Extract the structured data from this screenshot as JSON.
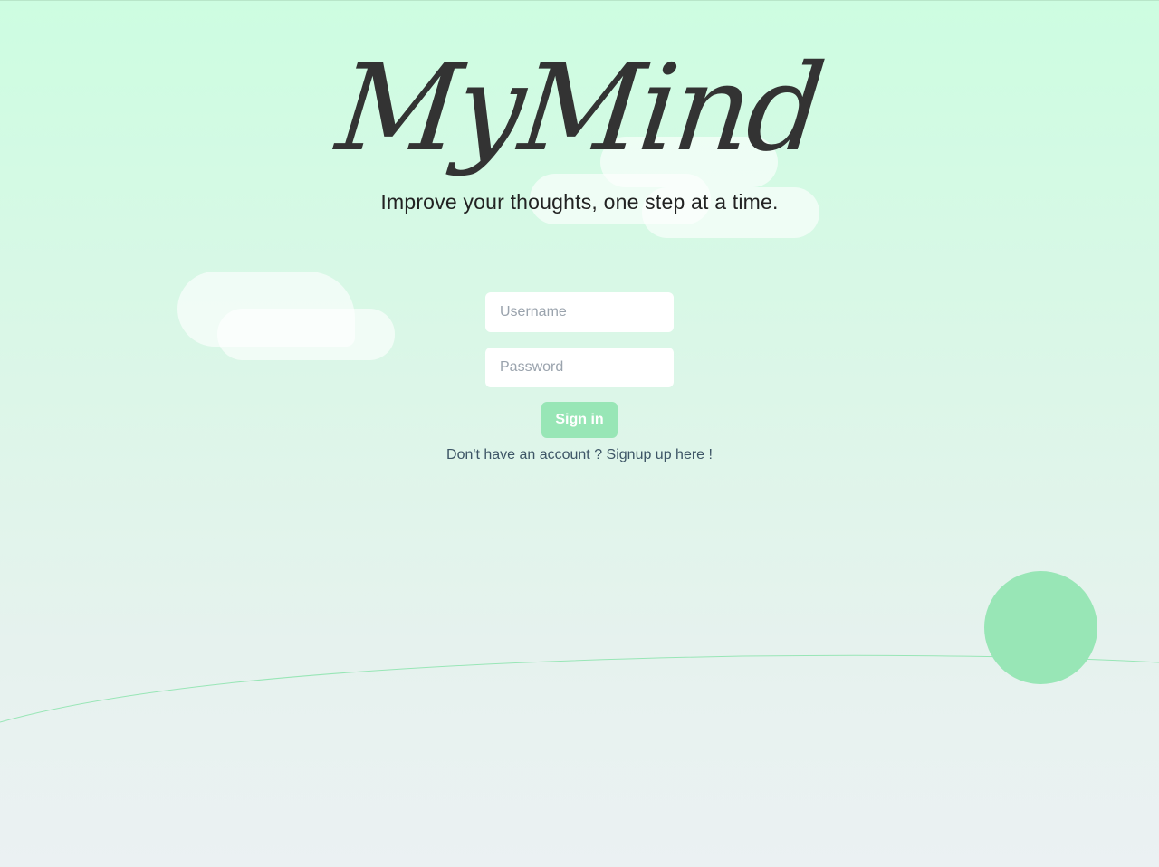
{
  "brand": {
    "logo": "MyMind",
    "tagline": "Improve your thoughts, one step at a time."
  },
  "login": {
    "username_placeholder": "Username",
    "password_placeholder": "Password",
    "signin_label": "Sign in",
    "signup_text": "Don't have an account ? Signup up here !"
  },
  "colors": {
    "accent": "#98e6b6",
    "background_top": "#cdfde1",
    "background_bottom": "#ebf1f3",
    "text_dark": "#333333",
    "link_text": "#3d5566"
  }
}
